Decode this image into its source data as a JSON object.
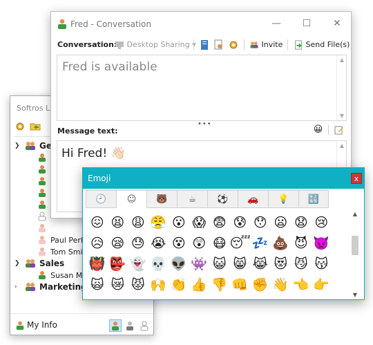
{
  "contacts": {
    "title": "Softros LA",
    "groups": [
      {
        "label": "Gen",
        "expanded": true
      },
      {
        "label": "Sales",
        "expanded": true
      },
      {
        "label": "Marketing",
        "expanded": false
      }
    ],
    "users": {
      "general": [
        "",
        "",
        "",
        "",
        "",
        "",
        "",
        "Paul Perk",
        "Tom Smi"
      ],
      "sales": [
        "Susan Mo"
      ]
    },
    "my_info": "My Info"
  },
  "conversation": {
    "title": "Fred - Conversation",
    "toolbar_label": "Conversation:",
    "desktop_sharing": "Desktop Sharing",
    "invite": "Invite",
    "send_files": "Send File(s)",
    "status_text": "Fred is available",
    "message_label": "Message text:",
    "message_value": "Hi Fred! 👋🏻"
  },
  "emoji_panel": {
    "title": "Emoji",
    "close": "x",
    "tabs": [
      {
        "icon": "recent-icon",
        "glyph": "🕘"
      },
      {
        "icon": "smileys-icon",
        "glyph": "☺"
      },
      {
        "icon": "animals-icon",
        "glyph": "🐻"
      },
      {
        "icon": "food-icon",
        "glyph": "☕"
      },
      {
        "icon": "activity-icon",
        "glyph": "⚽"
      },
      {
        "icon": "travel-icon",
        "glyph": "🚗"
      },
      {
        "icon": "objects-icon",
        "glyph": "💡"
      },
      {
        "icon": "symbols-icon",
        "glyph": "🔣"
      }
    ],
    "active_tab": 1,
    "emojis": [
      "😖",
      "😫",
      "😩",
      "😤",
      "😮",
      "😱",
      "😨",
      "😰",
      "😯",
      "😦",
      "😧",
      "😢",
      "😥",
      "😪",
      "😓",
      "😭",
      "😵",
      "😲",
      "😷",
      "😴",
      "💤",
      "💩",
      "😈",
      "👿",
      "👹",
      "👺",
      "👻",
      "💀",
      "👽",
      "👾",
      "😺",
      "😸",
      "😹",
      "😻",
      "😼",
      "😽",
      "🙀",
      "😿",
      "😾",
      "🙌",
      "👏",
      "👍",
      "👎",
      "👊",
      "✊",
      "👋",
      "👈",
      "👉"
    ]
  },
  "colors": {
    "accent": "#0fb0c4",
    "close_red": "#cc3636"
  }
}
